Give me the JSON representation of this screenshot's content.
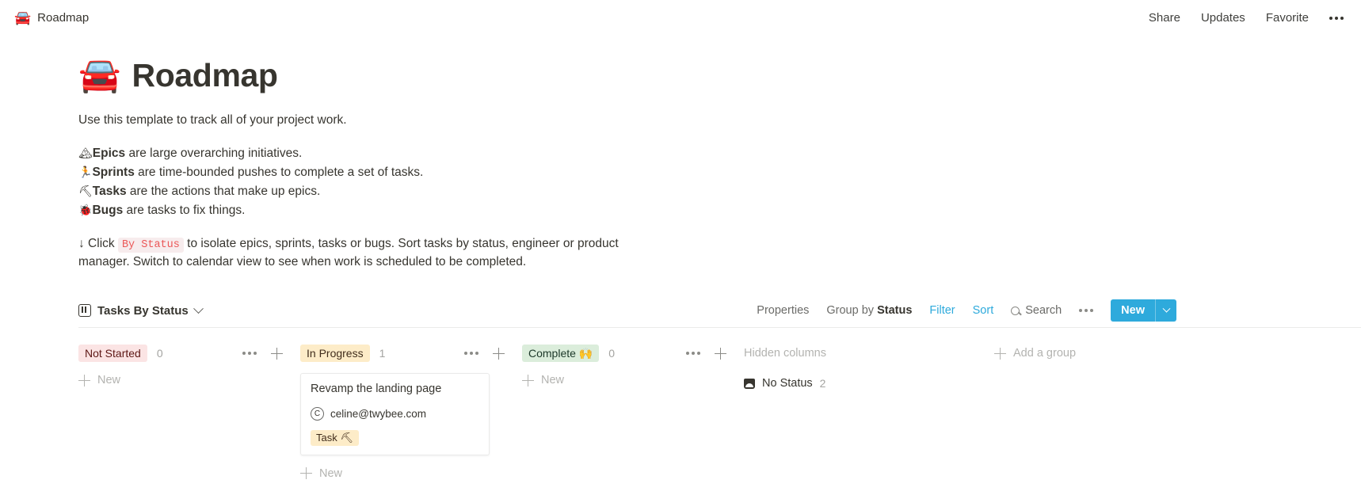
{
  "topbar": {
    "emoji": "🚘",
    "breadcrumb": "Roadmap",
    "share": "Share",
    "updates": "Updates",
    "favorite": "Favorite",
    "more_icon": "more-horizontal-icon"
  },
  "page": {
    "emoji": "🚘",
    "title": "Roadmap",
    "intro": "Use this template to track all of your project work.",
    "bullets": [
      {
        "emoji": "🏔",
        "term": "Epics",
        "rest": " are large overarching initiatives."
      },
      {
        "emoji": "🏃",
        "term": "Sprints",
        "rest": " are time-bounded pushes to complete a set of tasks."
      },
      {
        "emoji": "⛏",
        "term": "Tasks",
        "rest": " are the actions that make up epics."
      },
      {
        "emoji": "🐞",
        "term": "Bugs",
        "rest": " are tasks to fix things."
      }
    ],
    "paragraph_before": "↓ Click ",
    "paragraph_code": "By Status",
    "paragraph_after": " to isolate epics, sprints, tasks or bugs. Sort tasks by status, engineer or product manager. Switch to calendar view to see when work is scheduled to be completed."
  },
  "toolbar": {
    "view_name": "Tasks By Status",
    "properties": "Properties",
    "group_by_prefix": "Group by ",
    "group_by_value": "Status",
    "filter": "Filter",
    "sort": "Sort",
    "search": "Search",
    "more_icon": "more-horizontal-icon",
    "new_label": "New",
    "accent_color": "#2eaadc"
  },
  "board": {
    "columns": [
      {
        "name": "Not Started",
        "count": "0",
        "pill_bg": "#fbe4e4",
        "pill_color": "#5d1715",
        "new_label": "New",
        "cards": []
      },
      {
        "name": "In Progress",
        "count": "1",
        "pill_bg": "#fdecc8",
        "pill_color": "#402c1b",
        "new_label": "New",
        "cards": [
          {
            "title": "Revamp the landing page",
            "avatar_initial": "C",
            "person": "celine@twybee.com",
            "tag": "Task ⛏"
          }
        ]
      },
      {
        "name": "Complete 🙌",
        "count": "0",
        "pill_bg": "#dbeddb",
        "pill_color": "#1c3829",
        "new_label": "New",
        "cards": []
      }
    ],
    "hidden": {
      "header": "Hidden columns",
      "items": [
        {
          "name": "No Status",
          "count": "2",
          "icon": "hide-icon"
        }
      ]
    },
    "add_group": "Add a group"
  }
}
